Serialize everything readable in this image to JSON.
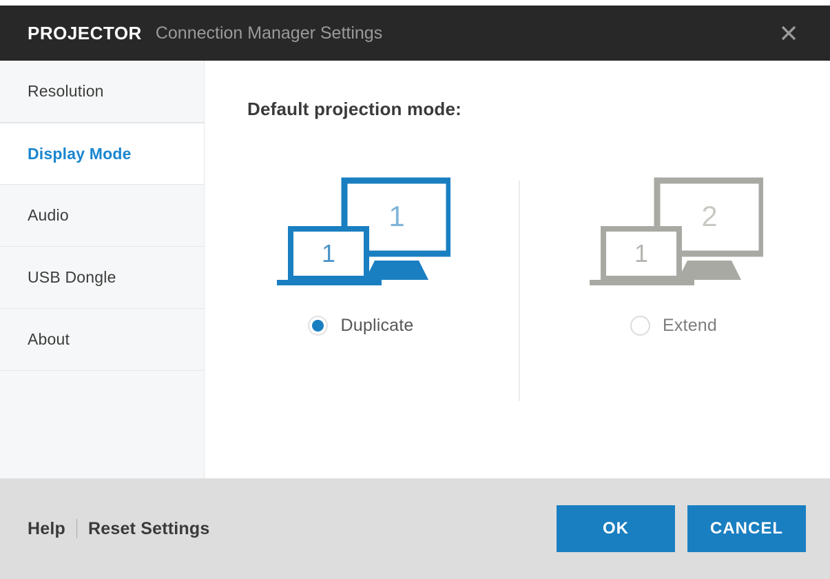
{
  "window": {
    "brand": "PROJECTOR",
    "subtitle": "Connection Manager Settings",
    "close_label": "×",
    "close_icon": "close-icon",
    "titlebar_bg": "#282828",
    "accent_color": "#1a7fc1"
  },
  "sidebar": {
    "items": [
      {
        "label": "Resolution",
        "active": false
      },
      {
        "label": "Display Mode",
        "active": true
      },
      {
        "label": "Audio",
        "active": false
      },
      {
        "label": "USB Dongle",
        "active": false
      },
      {
        "label": "About",
        "active": false
      }
    ]
  },
  "main": {
    "heading": "Default projection mode:",
    "options": [
      {
        "id": "duplicate",
        "label": "Duplicate",
        "selected": true,
        "illustration": {
          "icon": "duplicate-displays-icon",
          "color": "#1a7fc1",
          "monitor_number": "1",
          "laptop_number": "1"
        }
      },
      {
        "id": "extend",
        "label": "Extend",
        "selected": false,
        "illustration": {
          "icon": "extend-displays-icon",
          "color": "#a9a9a4",
          "monitor_number": "2",
          "laptop_number": "1"
        }
      }
    ]
  },
  "footer": {
    "help_label": "Help",
    "reset_label": "Reset Settings",
    "ok_label": "OK",
    "cancel_label": "CANCEL"
  }
}
